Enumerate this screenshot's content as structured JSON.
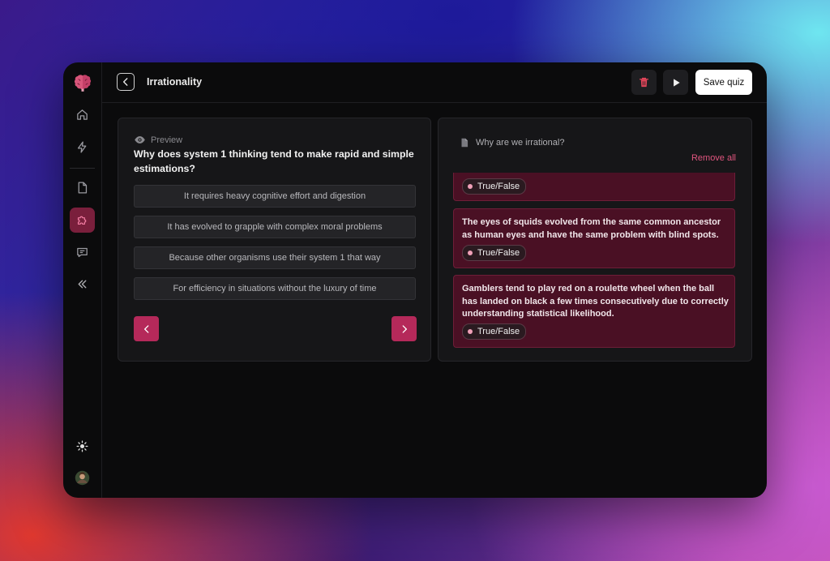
{
  "app": {
    "title": "Irrationality"
  },
  "toolbar": {
    "save_label": "Save quiz"
  },
  "sidebar": {
    "items": [
      {
        "name": "home"
      },
      {
        "name": "lightning"
      },
      {
        "name": "document"
      },
      {
        "name": "puzzle",
        "active": true
      },
      {
        "name": "chat"
      },
      {
        "name": "collapse"
      }
    ]
  },
  "preview": {
    "label": "Preview",
    "question": "Why does system 1 thinking tend to make rapid and simple estimations?",
    "options": [
      "It requires heavy cognitive effort and digestion",
      "It has evolved to grapple with complex moral problems",
      "Because other organisms use their system 1 that way",
      "For efficiency in situations without the luxury of time"
    ]
  },
  "questions_panel": {
    "doc_title": "Why are we irrational?",
    "remove_all_label": "Remove all",
    "cards": [
      {
        "text": "",
        "tag": "True/False"
      },
      {
        "text": "The eyes of squids evolved from the same common ancestor as human eyes and have the same problem with blind spots.",
        "tag": "True/False"
      },
      {
        "text": "Gamblers tend to play red on a roulette wheel when the ball has landed on black a few times consecutively due to correctly understanding statistical likelihood.",
        "tag": "True/False"
      }
    ]
  },
  "colors": {
    "accent": "#b5295a",
    "card_bg": "#4a1024",
    "remove_all": "#e0557f"
  }
}
